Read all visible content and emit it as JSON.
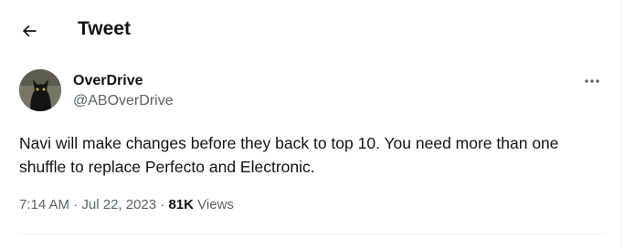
{
  "header": {
    "title": "Tweet",
    "back_icon": "arrow-left-icon"
  },
  "author": {
    "display_name": "OverDrive",
    "handle": "@ABOverDrive",
    "avatar_icon": "black-cat-avatar"
  },
  "more_icon": "ellipsis-icon",
  "tweet": {
    "text": "Navi will make changes before they back to top 10. You need more than one shuffle to replace Perfecto and Electronic.",
    "time": "7:14 AM",
    "separator": "·",
    "date": "Jul 22, 2023",
    "views_count": "81K",
    "views_label": "Views"
  },
  "colors": {
    "text_primary": "#0f1419",
    "text_secondary": "#536471",
    "divider": "#eff3f4"
  }
}
